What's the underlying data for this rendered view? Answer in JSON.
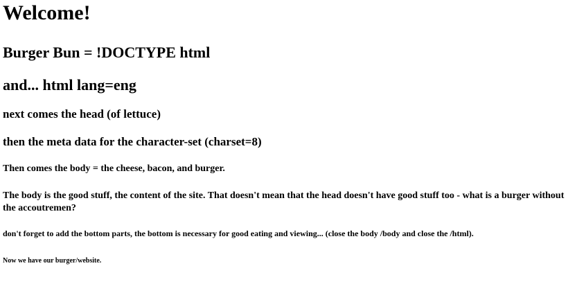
{
  "headings": {
    "welcome": "Welcome!",
    "burger_bun": "Burger Bun = !DOCTYPE html",
    "html_lang": "and... html lang=eng",
    "head": "next comes the head (of lettuce)",
    "meta": "then the meta data for the character-set (charset=8)",
    "body": "Then comes the body = the cheese, bacon, and burger.",
    "body_content": "The body is the good stuff, the content of the site. That doesn't mean that the head doesn't have good stuff too - what is a burger without the accoutremen?",
    "bottom": "don't forget to add the bottom parts, the bottom is necessary for good eating and viewing... (close the body /body and close the /html).",
    "website": "Now we have our burger/website."
  }
}
